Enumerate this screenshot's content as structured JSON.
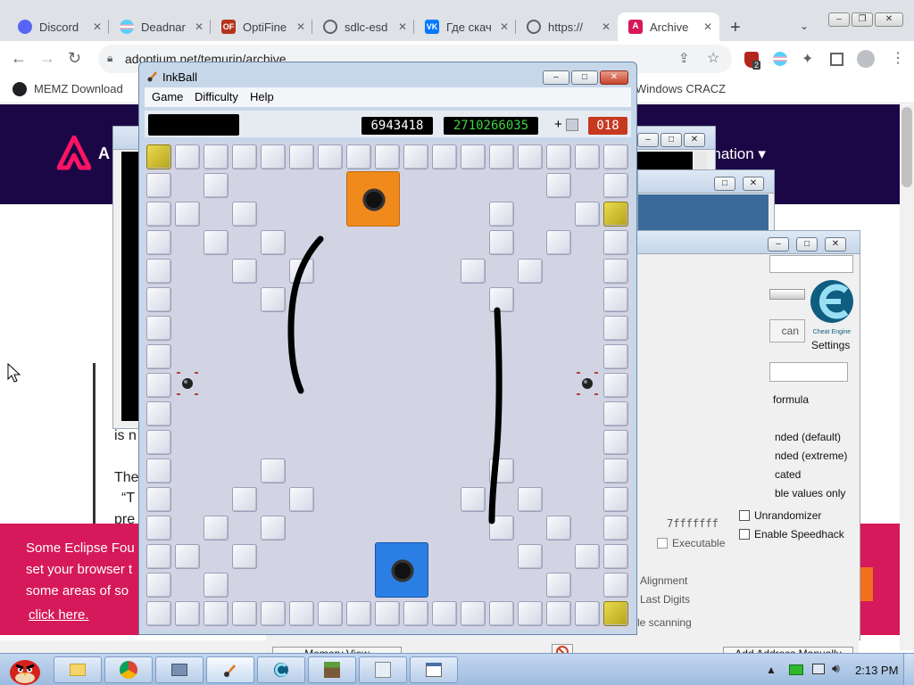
{
  "browser": {
    "tabs": [
      {
        "label": "Discord",
        "favicon": "discord-icon",
        "color": "#5865f2"
      },
      {
        "label": "Deadnar",
        "favicon": "trans-flag-icon",
        "color": "#f5a9b8"
      },
      {
        "label": "OptiFine",
        "favicon": "optifine-icon",
        "color": "#b5341a"
      },
      {
        "label": "sdlc-esd",
        "favicon": "globe-icon",
        "color": "#5f6368"
      },
      {
        "label": "Где скач",
        "favicon": "vk-icon",
        "color": "#0077ff"
      },
      {
        "label": "https://",
        "favicon": "globe-icon",
        "color": "#5f6368"
      },
      {
        "label": "Archive",
        "favicon": "adoptium-icon",
        "color": "#d6195a"
      }
    ],
    "new_tab": "+",
    "url": "adoptium.net/temurin/archive",
    "bookmarks": {
      "left": "MEMZ Download",
      "right": "Windows CRACZ"
    },
    "ext_badge": "2"
  },
  "site": {
    "logo_letter": "A",
    "nav_item": "rmation",
    "body_lines": [
      "is n",
      "The",
      "“T",
      "pre"
    ],
    "banner_lines": [
      "Some Eclipse Fou",
      "set your browser t",
      "some areas of so"
    ],
    "banner_link": "click here."
  },
  "cheat_engine": {
    "settings_label": "Settings",
    "scan_btn": "can",
    "formula": "formula",
    "options": [
      "nded (default)",
      "nded (extreme)",
      "cated",
      "ble values only"
    ],
    "hex_value": "7fffffff",
    "executable": "Executable",
    "unrandomizer": "Unrandomizer",
    "speedhack": "Enable Speedhack",
    "alignment": "Alignment",
    "last_digits": "Last Digits",
    "scanning": "le scanning",
    "memory_view": "Memory View",
    "add_address": "Add Address Manually",
    "logo_caption": "Cheat Engine"
  },
  "inkball": {
    "title": "InkBall",
    "menu": [
      "Game",
      "Difficulty",
      "Help"
    ],
    "score": "6943418",
    "time": "2710266035",
    "plus": "+",
    "balls": "018",
    "colors": {
      "score": "#ffffff",
      "time": "#3fd43f",
      "balls_bg": "#c6391e"
    }
  },
  "taskbar": {
    "time": "2:13 PM"
  }
}
